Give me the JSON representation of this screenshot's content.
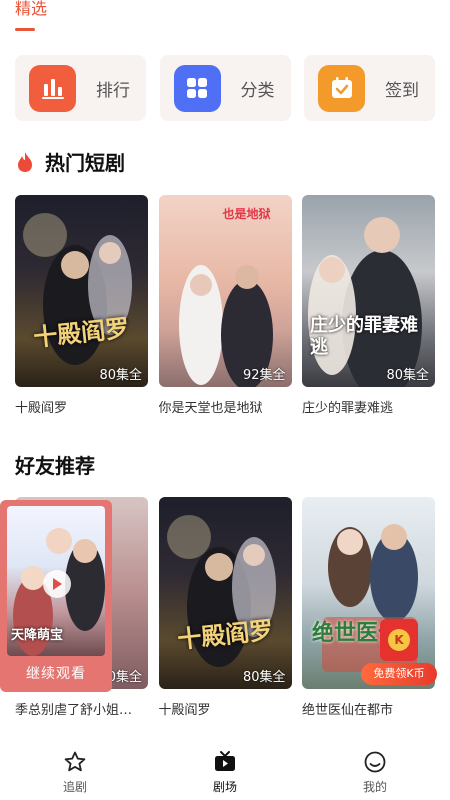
{
  "header": {
    "active_tab": "精选"
  },
  "quick_actions": [
    {
      "label": "排行",
      "icon": "ranking-chart-icon",
      "color": "#f15e3e"
    },
    {
      "label": "分类",
      "icon": "category-grid-icon",
      "color": "#4f6ff5"
    },
    {
      "label": "签到",
      "icon": "calendar-check-icon",
      "color": "#f49a2a"
    }
  ],
  "hot": {
    "title": "热门短剧",
    "icon": "flame-icon",
    "items": [
      {
        "title": "十殿阎罗",
        "episodes": "80集全",
        "cover_text": "十殿阎罗"
      },
      {
        "title": "你是天堂也是地狱",
        "episodes": "92集全",
        "cover_text": "也是地狱"
      },
      {
        "title": "庄少的罪妻难逃",
        "episodes": "80集全",
        "cover_text": "庄少的罪妻难逃"
      }
    ]
  },
  "friends": {
    "title": "好友推荐",
    "items": [
      {
        "title": "季总别虐了舒小姐…",
        "episodes": "80集全",
        "cover_text": ""
      },
      {
        "title": "十殿阎罗",
        "episodes": "80集全",
        "cover_text": "十殿阎罗"
      },
      {
        "title": "绝世医仙在都市",
        "episodes": "",
        "cover_text": "绝世医仙"
      }
    ]
  },
  "continue_watching": {
    "label": "继续观看",
    "cover_text": "天降萌宝"
  },
  "reward": {
    "label": "免费领K币",
    "coin": "K"
  },
  "bottom_nav": [
    {
      "label": "追剧",
      "icon": "star-icon",
      "active": false
    },
    {
      "label": "剧场",
      "icon": "tv-icon",
      "active": true
    },
    {
      "label": "我的",
      "icon": "profile-icon",
      "active": false
    }
  ]
}
